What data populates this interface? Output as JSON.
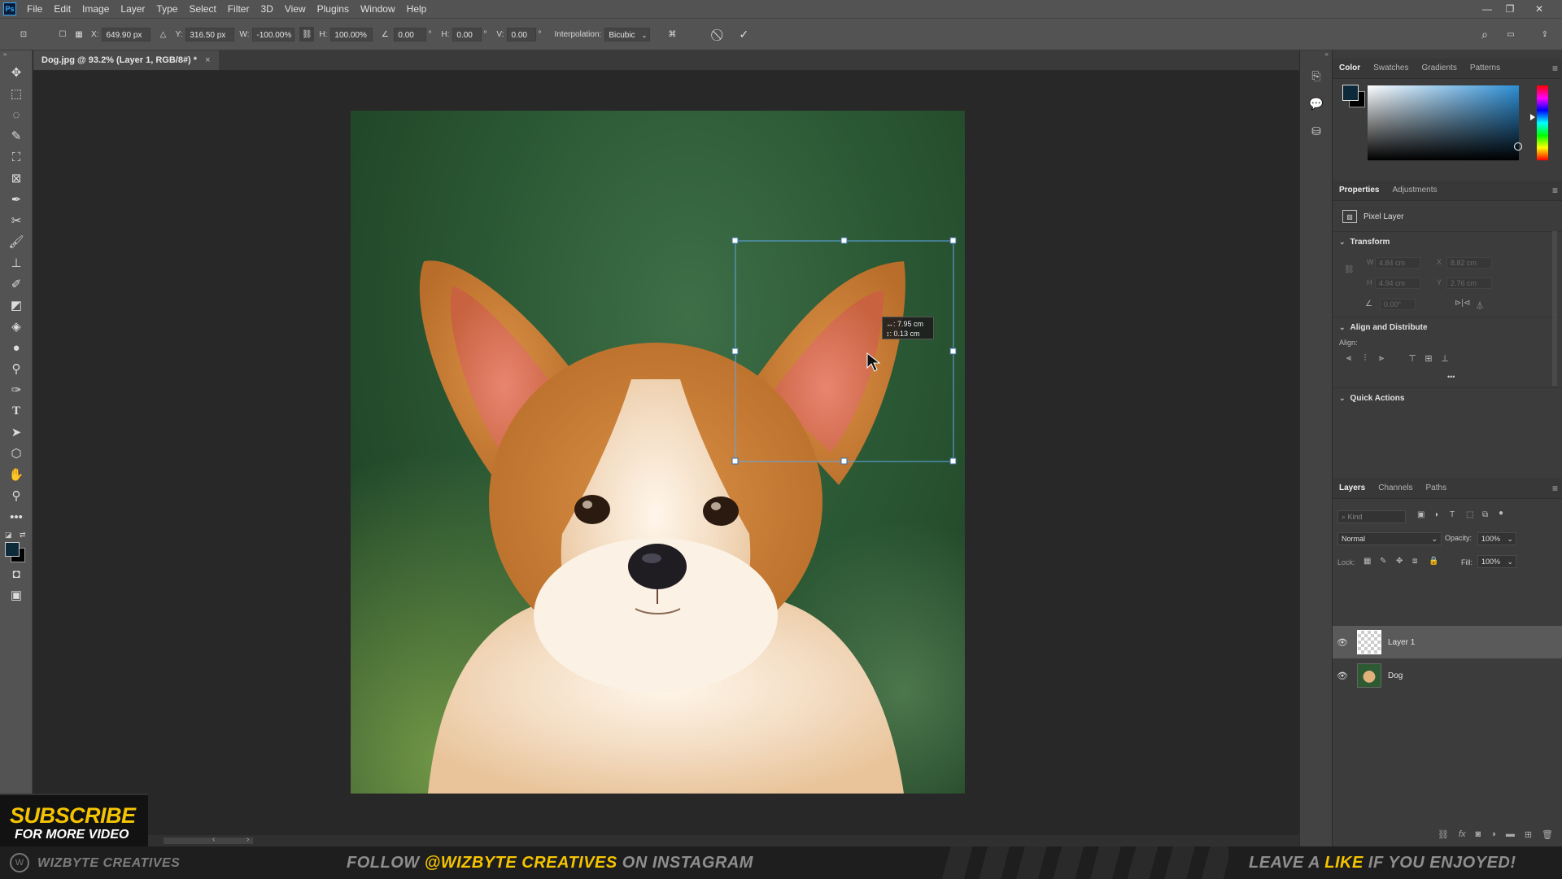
{
  "app": {
    "logo": "Ps",
    "menu": [
      "File",
      "Edit",
      "Image",
      "Layer",
      "Type",
      "Select",
      "Filter",
      "3D",
      "View",
      "Plugins",
      "Window",
      "Help"
    ]
  },
  "options": {
    "x_label": "X:",
    "x_value": "649.90 px",
    "y_label": "Y:",
    "y_value": "316.50 px",
    "w_label": "W:",
    "w_value": "-100.00%",
    "h_label": "H:",
    "h_value": "100.00%",
    "angle_value": "0.00",
    "hskew_label": "H:",
    "hskew_value": "0.00",
    "vskew_label": "V:",
    "vskew_value": "0.00",
    "degree_symbol": "°",
    "interpolation_label": "Interpolation:",
    "interpolation_value": "Bicubic"
  },
  "document": {
    "tab_title": "Dog.jpg @ 93.2% (Layer 1, RGB/8#) *",
    "tab_close": "×"
  },
  "transform_tooltip": {
    "line1": "↔: 7.95 cm",
    "line2": "↕: 0.13 cm"
  },
  "color_panel": {
    "tabs": [
      "Color",
      "Swatches",
      "Gradients",
      "Patterns"
    ],
    "foreground": "#0d2a3a",
    "background": "#000000"
  },
  "properties_panel": {
    "tabs": [
      "Properties",
      "Adjustments"
    ],
    "layer_type": "Pixel Layer",
    "transform_title": "Transform",
    "w_label": "W",
    "w_value": "4.84 cm",
    "h_label": "H",
    "h_value": "4.94 cm",
    "x_label": "X",
    "x_value": "8.82 cm",
    "y_label": "Y",
    "y_value": "2.76 cm",
    "angle_value": "0.00°",
    "align_title": "Align and Distribute",
    "align_label": "Align:",
    "more": "•••",
    "quick_actions_title": "Quick Actions"
  },
  "layers_panel": {
    "tabs": [
      "Layers",
      "Channels",
      "Paths"
    ],
    "kind_placeholder": "Kind",
    "blend_mode": "Normal",
    "opacity_label": "Opacity:",
    "opacity_value": "100%",
    "lock_label": "Lock:",
    "fill_label": "Fill:",
    "fill_value": "100%",
    "layers": [
      {
        "name": "Layer 1",
        "selected": true
      },
      {
        "name": "Dog",
        "selected": false
      }
    ]
  },
  "overlay": {
    "subscribe_line1": "SUBSCRIBE",
    "subscribe_line2": "FOR MORE VIDEO",
    "brand": "WIZBYTE CREATIVES",
    "follow_prefix": "FOLLOW ",
    "follow_handle": "@WIZBYTE CREATIVES",
    "follow_suffix": " ON INSTAGRAM",
    "leave_prefix": "LEAVE A ",
    "leave_like": "LIKE",
    "leave_suffix": " IF YOU ENJOYED!"
  },
  "colors": {
    "accent_yellow": "#f5c400",
    "ps_blue": "#31a8ff",
    "ui_gray": "#535353"
  }
}
